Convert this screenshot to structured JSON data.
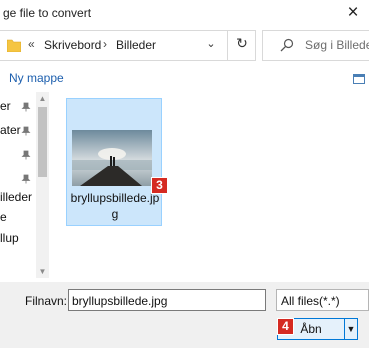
{
  "window": {
    "title": "ge file to convert",
    "close_glyph": "×"
  },
  "address_bar": {
    "separator": "«",
    "crumbs": [
      "Skrivebord",
      "Billeder"
    ],
    "crumb_separator": "›",
    "dropdown_glyph": "⌄",
    "refresh_glyph": "↻"
  },
  "search": {
    "placeholder": "Søg i Billeder"
  },
  "toolbar": {
    "new_folder_label": "Ny mappe"
  },
  "nav_pane": {
    "items": [
      {
        "label": "er",
        "pinned": true
      },
      {
        "label": "ater",
        "pinned": true
      },
      {
        "label": "",
        "pinned": true
      },
      {
        "label": "",
        "pinned": true
      },
      {
        "label": "illeder",
        "pinned": false
      },
      {
        "label": "e",
        "pinned": false
      },
      {
        "label": "llup",
        "pinned": false
      }
    ]
  },
  "files": [
    {
      "name_line1": "bryllupsbillede.jp",
      "name_line2": "g",
      "selected": true,
      "badge": "3"
    }
  ],
  "footer": {
    "filename_label": "Filnavn:",
    "filename_value": "bryllupsbillede.jpg",
    "filter_value": "All files(*.*)",
    "open_label": "Åbn",
    "open_badge": "4",
    "open_dropdown_glyph": "▼"
  },
  "colors": {
    "selection": "#cce6fb",
    "selection_border": "#99d1ff",
    "link_blue": "#1d5fae",
    "badge_red": "#d52a22",
    "primary_border": "#0078d7"
  }
}
